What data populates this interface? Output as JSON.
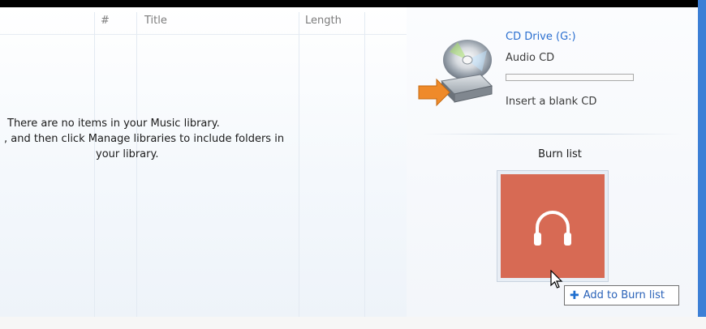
{
  "library": {
    "columns": [
      "#",
      "Title",
      "Length"
    ],
    "empty_line1": "There are no items in your Music library.",
    "empty_line2": ", and then click Manage libraries to include folders in",
    "empty_line3": "your library."
  },
  "device": {
    "icon": "cd-drive-icon",
    "title": "CD Drive (G:)",
    "subtitle": "Audio CD",
    "capacity_fill": 0,
    "hint": "Insert a blank CD"
  },
  "burn": {
    "title": "Burn list",
    "tile_icon": "headphones-icon",
    "tile_color": "#d76a54"
  },
  "tooltip": {
    "icon": "plus-icon",
    "label": "Add to Burn list"
  },
  "colors": {
    "accent_blue": "#3c7fd6",
    "link_blue": "#2a6fd0"
  }
}
